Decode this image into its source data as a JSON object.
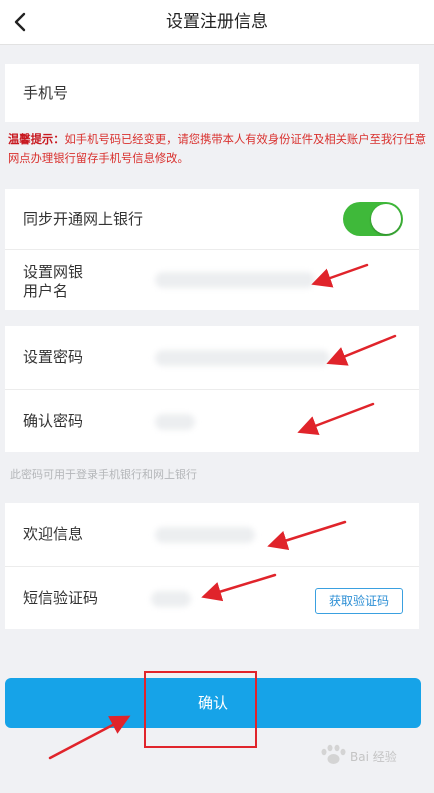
{
  "header": {
    "title": "设置注册信息",
    "back_icon": "chevron-left-icon"
  },
  "phone": {
    "label": "手机号"
  },
  "tip": {
    "prefix": "温馨提示：",
    "text": "如手机号码已经变更，请您携带本人有效身份证件及相关账户至我行任意网点办理银行留存手机号信息修改。"
  },
  "sync": {
    "label": "同步开通网上银行",
    "toggle_on": true,
    "toggle_color": "#3fb93a"
  },
  "form1": {
    "username_label": "设置网银用户名",
    "username_line1": "设置网银",
    "username_line2": "用户名",
    "password_label": "设置密码",
    "confirm_password_label": "确认密码"
  },
  "note": "此密码可用于登录手机银行和网上银行",
  "form2": {
    "welcome_label": "欢迎信息",
    "sms_label": "短信验证码",
    "get_code_button": "获取验证码"
  },
  "confirm_button": "确认",
  "colors": {
    "accent": "#16a3e8",
    "annotation_red": "#e0242b",
    "tip_red": "#d9302d"
  },
  "watermark": "Bai 经验"
}
